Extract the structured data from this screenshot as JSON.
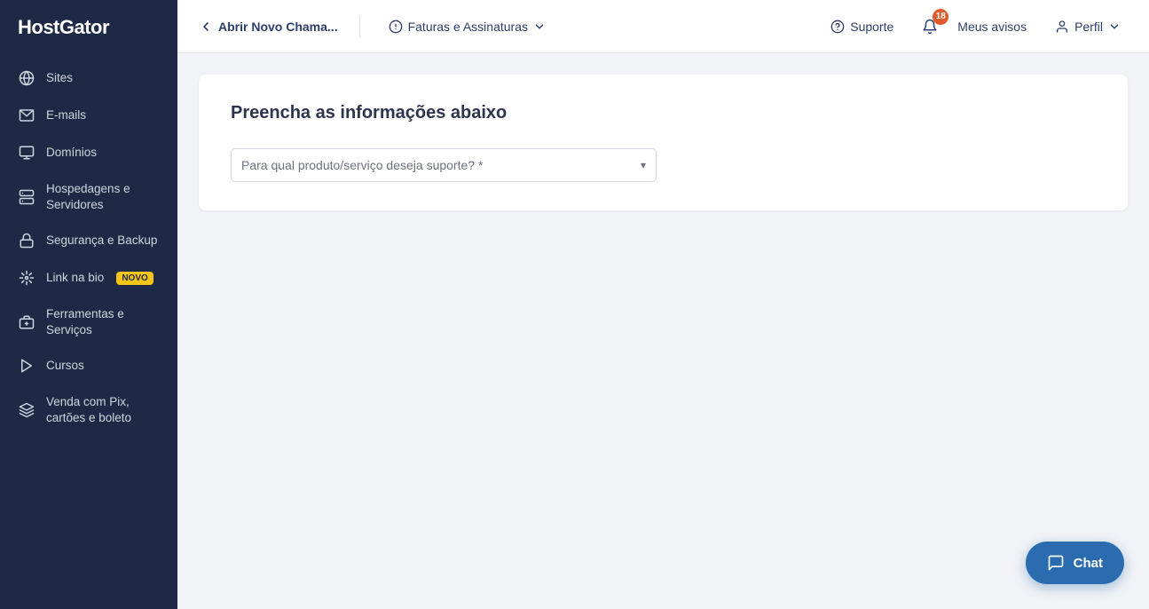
{
  "brand": {
    "logo": "HostGator"
  },
  "sidebar": {
    "items": [
      {
        "id": "sites",
        "label": "Sites",
        "icon": "globe"
      },
      {
        "id": "emails",
        "label": "E-mails",
        "icon": "email"
      },
      {
        "id": "dominios",
        "label": "Domínios",
        "icon": "domain"
      },
      {
        "id": "hospedagens",
        "label": "Hospedagens e Servidores",
        "icon": "server"
      },
      {
        "id": "seguranca",
        "label": "Segurança e Backup",
        "icon": "lock"
      },
      {
        "id": "linkbio",
        "label": "Link na bio",
        "icon": "link",
        "badge": "NOVO"
      },
      {
        "id": "ferramentas",
        "label": "Ferramentas e Serviços",
        "icon": "tools"
      },
      {
        "id": "cursos",
        "label": "Cursos",
        "icon": "courses"
      },
      {
        "id": "venda",
        "label": "Venda com Pix, cartões e boleto",
        "icon": "pix"
      }
    ]
  },
  "topbar": {
    "back_label": "Abrir Novo Chama...",
    "billing_label": "Faturas e Assinaturas",
    "support_label": "Suporte",
    "notifications_label": "Meus avisos",
    "notifications_count": "18",
    "profile_label": "Perfil"
  },
  "main": {
    "card_title": "Preencha as informações abaixo",
    "select_placeholder": "Para qual produto/serviço deseja suporte? *"
  },
  "chat": {
    "label": "Chat"
  }
}
